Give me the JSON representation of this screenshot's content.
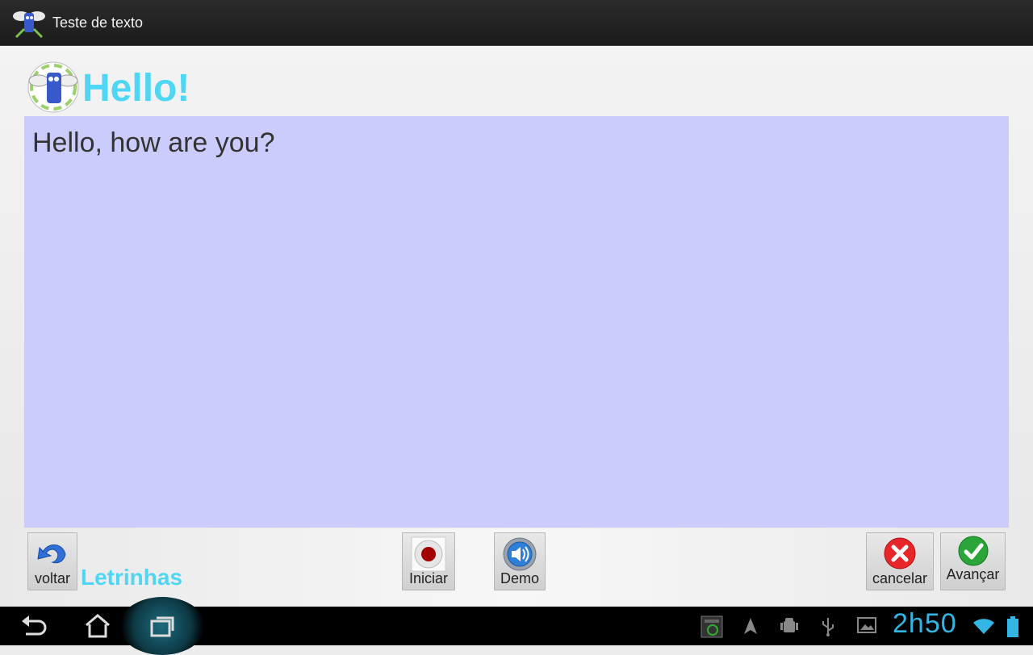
{
  "titlebar": {
    "title": "Teste de texto",
    "icon": "app-mascot-icon"
  },
  "header": {
    "title": "Hello!",
    "avatar": "mascot-avatar-icon"
  },
  "main": {
    "text": "Hello, how are you?",
    "background": "#cbccfb"
  },
  "bottom": {
    "back_label": "voltar",
    "brand": "Letrinhas",
    "record_label": "Iniciar",
    "demo_label": "Demo",
    "cancel_label": "cancelar",
    "next_label": "Avançar"
  },
  "navbar": {
    "clock": "2h50"
  },
  "colors": {
    "accent": "#4fd6f5",
    "clock": "#33b5e5",
    "cancel": "#e8262a",
    "ok": "#2aa53a"
  }
}
